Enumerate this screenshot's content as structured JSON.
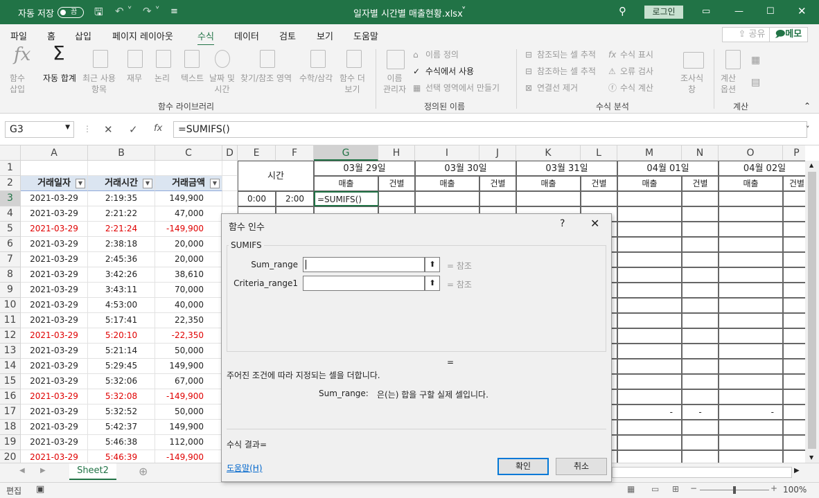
{
  "titlebar": {
    "autosave": "자동 저장",
    "toggle": "끔",
    "filename": "일자별 시간별 매출현황.xlsx",
    "login": "로그인"
  },
  "menu": [
    "파일",
    "홈",
    "삽입",
    "페이지 레이아웃",
    "수식",
    "데이터",
    "검토",
    "보기",
    "도움말"
  ],
  "share": "공유",
  "memo": "메모",
  "ribbon": {
    "btn_insert_fn": "함수\n삽입",
    "autosum": "자동 합계",
    "recent": "최근 사용\n항목",
    "finance": "재무",
    "logic": "논리",
    "text": "텍스트",
    "datetime": "날짜 및\n시간",
    "lookup": "찾기/참조 영역",
    "math": "수학/삼각",
    "more": "함수 더\n보기",
    "group_library": "함수 라이브러리",
    "name_mgr": "이름\n관리자",
    "define_name": "이름 정의",
    "use_in_formula": "수식에서 사용",
    "create_sel": "선택 영역에서 만들기",
    "group_names": "정의된 이름",
    "trace_prec": "참조되는 셀 추적",
    "trace_dep": "참조하는 셀 추적",
    "remove_arrows": "연결선 제거",
    "show_formulas": "수식 표시",
    "error_check": "오류 검사",
    "eval_formula": "수식 계산",
    "watch": "조사식\n창",
    "group_audit": "수식 분석",
    "calc_options": "계산\n옵션",
    "group_calc": "계산"
  },
  "formula_bar": {
    "cell_ref": "G3",
    "formula": "=SUMIFS()"
  },
  "columns": [
    "A",
    "B",
    "C",
    "D",
    "E",
    "F",
    "G",
    "H",
    "I",
    "J",
    "K",
    "L",
    "M",
    "N",
    "O",
    "P"
  ],
  "header": {
    "date": "거래일자",
    "time": "거래시간",
    "amount": "거래금액",
    "time_group": "시간",
    "sales": "매출",
    "count": "건별",
    "dates": [
      "03월 29일",
      "03월 30일",
      "03월 31일",
      "04월 01일",
      "04월 02일"
    ]
  },
  "e3": "0:00",
  "f3": "2:00",
  "g3": "=SUMIFS()",
  "rows": [
    {
      "n": "3",
      "date": "2021-03-29",
      "time": "2:19:35",
      "amount": "149,900",
      "red": false
    },
    {
      "n": "4",
      "date": "2021-03-29",
      "time": "2:21:22",
      "amount": "47,000",
      "red": false
    },
    {
      "n": "5",
      "date": "2021-03-29",
      "time": "2:21:24",
      "amount": "-149,900",
      "red": true
    },
    {
      "n": "6",
      "date": "2021-03-29",
      "time": "2:38:18",
      "amount": "20,000",
      "red": false
    },
    {
      "n": "7",
      "date": "2021-03-29",
      "time": "2:45:36",
      "amount": "20,000",
      "red": false
    },
    {
      "n": "8",
      "date": "2021-03-29",
      "time": "3:42:26",
      "amount": "38,610",
      "red": false
    },
    {
      "n": "9",
      "date": "2021-03-29",
      "time": "3:43:11",
      "amount": "70,000",
      "red": false
    },
    {
      "n": "10",
      "date": "2021-03-29",
      "time": "4:53:00",
      "amount": "40,000",
      "red": false
    },
    {
      "n": "11",
      "date": "2021-03-29",
      "time": "5:17:41",
      "amount": "22,350",
      "red": false
    },
    {
      "n": "12",
      "date": "2021-03-29",
      "time": "5:20:10",
      "amount": "-22,350",
      "red": true
    },
    {
      "n": "13",
      "date": "2021-03-29",
      "time": "5:21:14",
      "amount": "50,000",
      "red": false
    },
    {
      "n": "14",
      "date": "2021-03-29",
      "time": "5:29:45",
      "amount": "149,900",
      "red": false
    },
    {
      "n": "15",
      "date": "2021-03-29",
      "time": "5:32:06",
      "amount": "67,000",
      "red": false
    },
    {
      "n": "16",
      "date": "2021-03-29",
      "time": "5:32:08",
      "amount": "-149,900",
      "red": true
    },
    {
      "n": "17",
      "date": "2021-03-29",
      "time": "5:32:52",
      "amount": "50,000",
      "red": false
    },
    {
      "n": "18",
      "date": "2021-03-29",
      "time": "5:42:37",
      "amount": "149,900",
      "red": false
    },
    {
      "n": "19",
      "date": "2021-03-29",
      "time": "5:46:38",
      "amount": "112,000",
      "red": false
    },
    {
      "n": "20",
      "date": "2021-03-29",
      "time": "5:46:39",
      "amount": "-149,900",
      "red": true
    }
  ],
  "row17_dashes": [
    "-",
    "-",
    "-"
  ],
  "sheet_tab": "Sheet2",
  "status": {
    "mode": "편집",
    "zoom": "100%"
  },
  "dialog": {
    "title": "함수 인수",
    "help": "?",
    "fn": "SUMIFS",
    "args": [
      {
        "label": "Sum_range",
        "value": "",
        "result": "참조"
      },
      {
        "label": "Criteria_range1",
        "value": "",
        "result": "참조"
      }
    ],
    "eq": "=",
    "description": "주어진 조건에 따라 지정되는 셀을 더합니다.",
    "arg_help_name": "Sum_range:",
    "arg_help": "은(는) 합을 구할 실제 셀입니다.",
    "result_label": "수식 결과=",
    "help_link": "도움말(H)",
    "ok": "확인",
    "cancel": "취소"
  }
}
